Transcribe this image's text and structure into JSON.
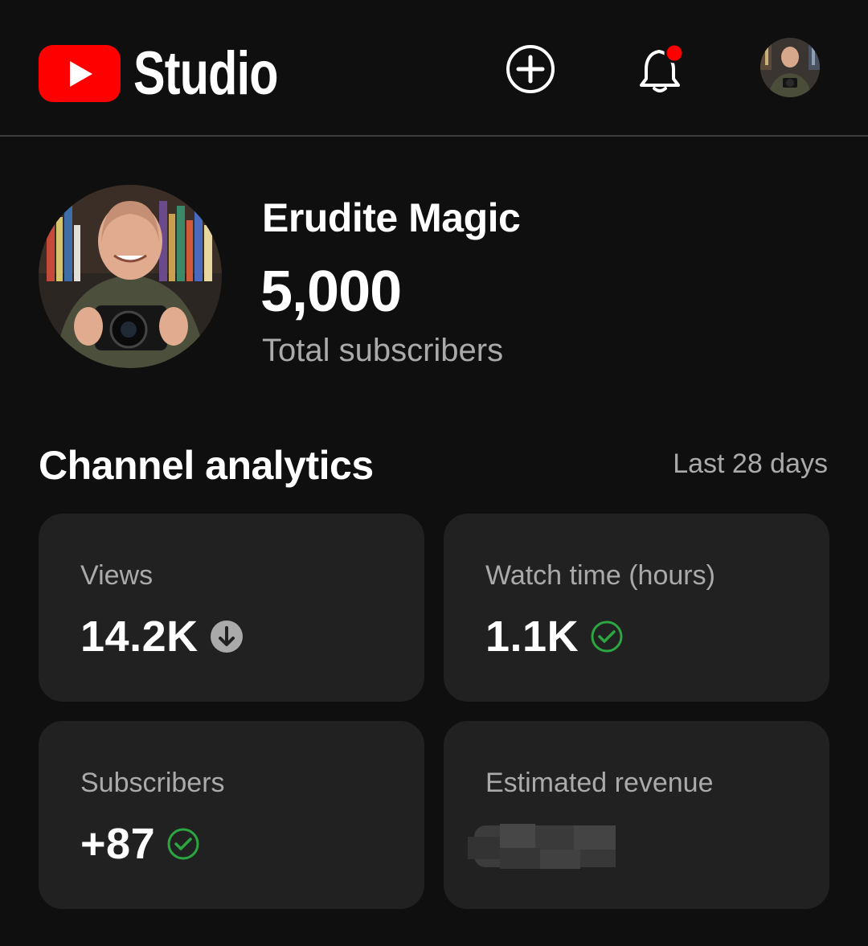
{
  "header": {
    "logo_text": "Studio",
    "icons": [
      "youtube-play-icon",
      "create-plus-icon",
      "notification-bell-icon",
      "account-avatar"
    ],
    "notification_dot_color": "#ff0000"
  },
  "channel": {
    "name": "Erudite Magic",
    "subscriber_count": "5,000",
    "subscriber_label": "Total subscribers"
  },
  "analytics": {
    "title": "Channel analytics",
    "period": "Last 28 days",
    "cards": [
      {
        "label": "Views",
        "value": "14.2K",
        "status_icon": "arrow-down-circle-icon"
      },
      {
        "label": "Watch time (hours)",
        "value": "1.1K",
        "status_icon": "check-circle-icon"
      },
      {
        "label": "Subscribers",
        "value": "+87",
        "status_icon": "check-circle-icon"
      },
      {
        "label": "Estimated revenue",
        "value": "",
        "status_icon": "redacted-value"
      }
    ]
  },
  "colors": {
    "background": "#0f0f0f",
    "card": "#212121",
    "brand_red": "#ff0000",
    "success_green": "#2ba640",
    "muted_text": "#aaaaaa"
  }
}
